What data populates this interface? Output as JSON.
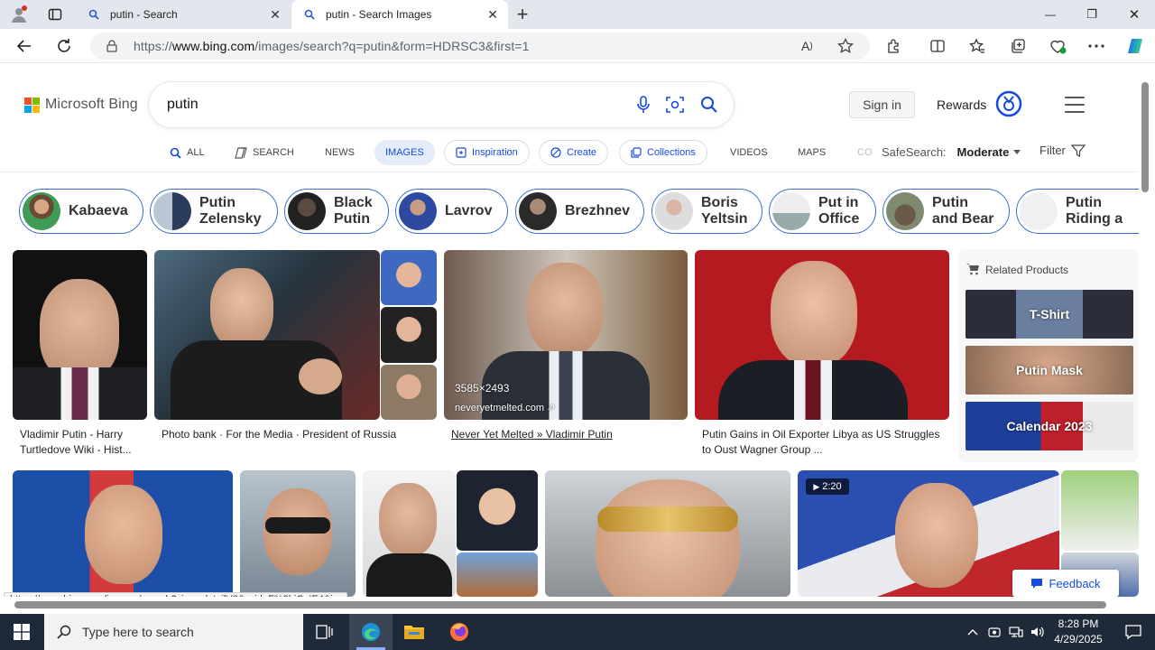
{
  "browser": {
    "tabs": [
      {
        "label": "putin - Search",
        "close": "✕"
      },
      {
        "label": "putin - Search Images",
        "close": "✕"
      }
    ],
    "new_tab": "+",
    "window_controls": {
      "minimize": "—",
      "maximize": "❐",
      "close": "✕"
    },
    "url_prefix": "https://",
    "url_host": "www.bing.com",
    "url_path": "/images/search?q=putin&form=HDRSC3&first=1",
    "read_aloud": "A"
  },
  "bing": {
    "logo_text": "Microsoft Bing",
    "query": "putin",
    "sign_in": "Sign in",
    "rewards": "Rewards",
    "scopes": {
      "all": "ALL",
      "search": "SEARCH",
      "news": "NEWS",
      "images": "IMAGES",
      "inspiration": "Inspiration",
      "create": "Create",
      "collections": "Collections",
      "videos": "VIDEOS",
      "maps": "MAPS",
      "more_truncated": "CO"
    },
    "safesearch_label": "SafeSearch:",
    "safesearch_value": "Moderate",
    "filter": "Filter",
    "related_chips": [
      {
        "label": "Kabaeva"
      },
      {
        "label": "Putin\nZelensky"
      },
      {
        "label": "Black\nPutin"
      },
      {
        "label": "Lavrov"
      },
      {
        "label": "Brezhnev"
      },
      {
        "label": "Boris\nYeltsin"
      },
      {
        "label": "Put in\nOffice"
      },
      {
        "label": "Putin\nand Bear"
      },
      {
        "label": "Putin\nRiding a"
      }
    ],
    "results": [
      {
        "caption": "Vladimir Putin - Harry\nTurtledove Wiki - Hist..."
      },
      {
        "caption": "Photo bank · For the Media · President of Russia"
      },
      {
        "caption": "Never Yet Melted » Vladimir Putin",
        "dimensions": "3585×2493",
        "source": "neveryetmelted.com"
      },
      {
        "caption": "Putin Gains in Oil Exporter Libya as US\nStruggles to Oust Wagner Group ..."
      }
    ],
    "video_duration": "2:20",
    "related_products": {
      "title": "Related Products",
      "items": [
        "T-Shirt",
        "Putin Mask",
        "Calendar 2023"
      ]
    },
    "feedback": "Feedback",
    "status_url": "https://www.bing.com/images/search?view=detailV2&ccid=F%2biCqIE4&i..."
  },
  "taskbar": {
    "search_placeholder": "Type here to search",
    "time": "8:28 PM",
    "date": "4/29/2025"
  },
  "colors": {
    "accent": "#174ae4",
    "chip_border": "#3c6fd1",
    "taskbar": "#1f2a38"
  }
}
